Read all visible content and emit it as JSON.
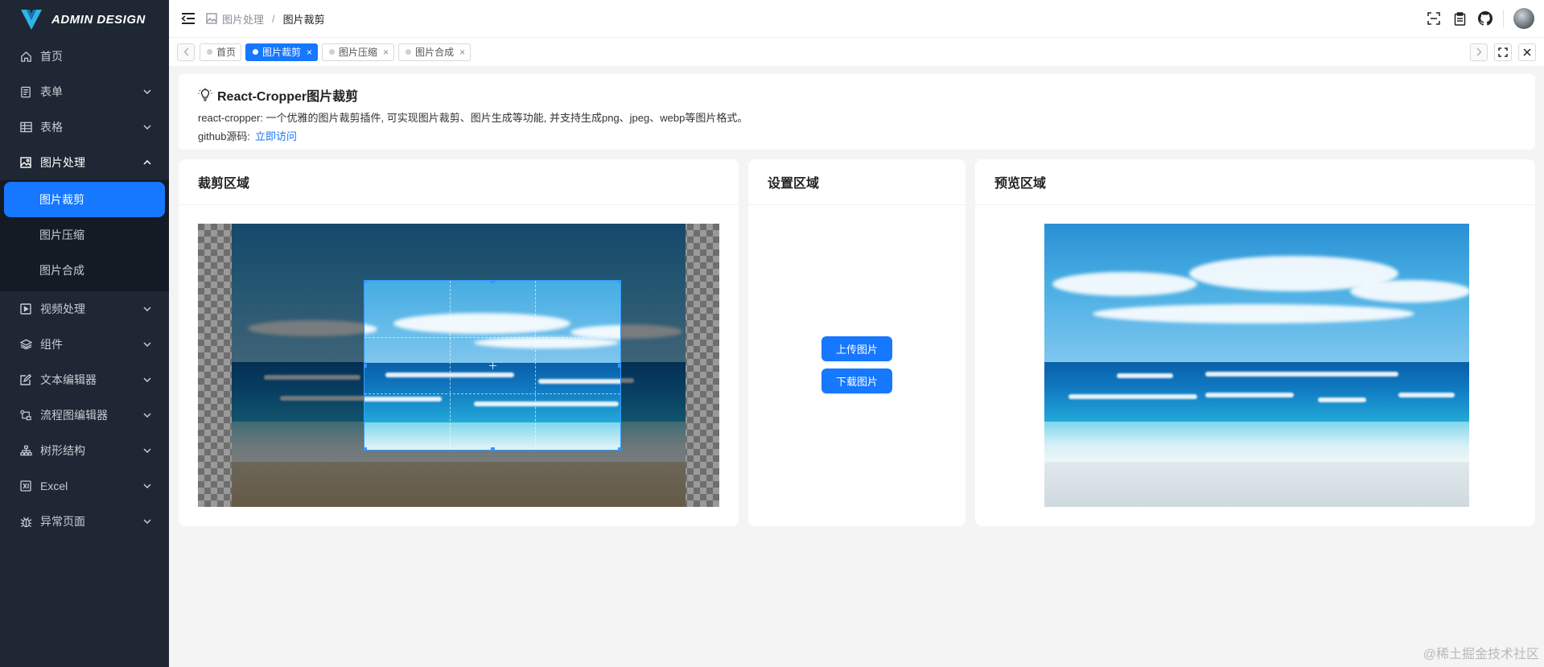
{
  "app": {
    "logo_text": "ADMIN DESIGN"
  },
  "sidebar": {
    "items": [
      {
        "label": "首页",
        "icon": "home-icon"
      },
      {
        "label": "表单",
        "icon": "form-icon"
      },
      {
        "label": "表格",
        "icon": "table-icon"
      },
      {
        "label": "图片处理",
        "icon": "image-icon",
        "open": true
      },
      {
        "label": "视频处理",
        "icon": "video-icon"
      },
      {
        "label": "组件",
        "icon": "layers-icon"
      },
      {
        "label": "文本编辑器",
        "icon": "edit-icon"
      },
      {
        "label": "流程图编辑器",
        "icon": "flow-icon"
      },
      {
        "label": "树形结构",
        "icon": "tree-icon"
      },
      {
        "label": "Excel",
        "icon": "excel-icon"
      },
      {
        "label": "异常页面",
        "icon": "bug-icon"
      }
    ],
    "submenu": [
      {
        "label": "图片裁剪",
        "active": true
      },
      {
        "label": "图片压缩"
      },
      {
        "label": "图片合成"
      }
    ]
  },
  "header": {
    "breadcrumb": [
      "图片处理",
      "图片裁剪"
    ],
    "separator": "/"
  },
  "tabs": [
    {
      "label": "首页",
      "active": false,
      "closable": false
    },
    {
      "label": "图片裁剪",
      "active": true,
      "closable": true
    },
    {
      "label": "图片压缩",
      "active": false,
      "closable": true
    },
    {
      "label": "图片合成",
      "active": false,
      "closable": true
    }
  ],
  "info": {
    "title": "React-Cropper图片裁剪",
    "description": "react-cropper: 一个优雅的图片裁剪插件, 可实现图片裁剪、图片生成等功能, 并支持生成png、jpeg、webp等图片格式。",
    "source_label": "github源码:",
    "source_link": "立即访问"
  },
  "panels": {
    "crop_title": "裁剪区域",
    "settings_title": "设置区域",
    "preview_title": "预览区域",
    "upload_label": "上传图片",
    "download_label": "下载图片"
  },
  "watermark": "@稀土掘金技术社区",
  "colors": {
    "sidebar_bg": "#1e2733",
    "accent": "#1677ff",
    "page_bg": "#f4f4f5"
  }
}
